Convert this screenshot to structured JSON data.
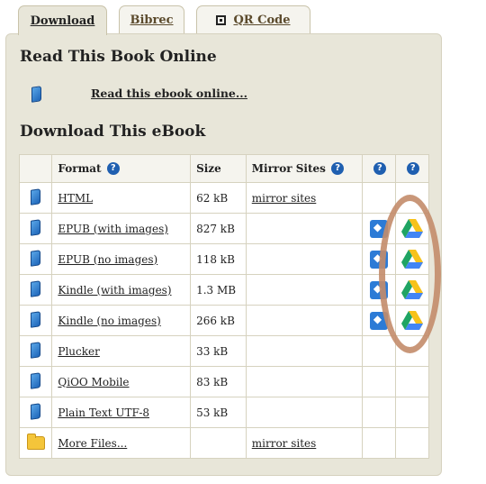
{
  "tabs": [
    {
      "label": "Download",
      "active": true
    },
    {
      "label": "Bibrec",
      "active": false
    },
    {
      "label": "QR Code",
      "active": false
    }
  ],
  "read_section": {
    "title": "Read This Book Online",
    "link": "Read this ebook online..."
  },
  "download_section": {
    "title": "Download This eBook",
    "columns": {
      "format": "Format",
      "size": "Size",
      "mirror": "Mirror Sites",
      "help": "?"
    },
    "rows": [
      {
        "format": "HTML",
        "size": "62 kB",
        "mirror": "mirror sites",
        "dropbox": false,
        "gdrive": false,
        "icon": "book-icon"
      },
      {
        "format": "EPUB (with images)",
        "size": "827 kB",
        "mirror": "",
        "dropbox": true,
        "gdrive": true,
        "icon": "book-icon"
      },
      {
        "format": "EPUB (no images)",
        "size": "118 kB",
        "mirror": "",
        "dropbox": true,
        "gdrive": true,
        "icon": "book-icon"
      },
      {
        "format": "Kindle (with images)",
        "size": "1.3 MB",
        "mirror": "",
        "dropbox": true,
        "gdrive": true,
        "icon": "book-icon"
      },
      {
        "format": "Kindle (no images)",
        "size": "266 kB",
        "mirror": "",
        "dropbox": true,
        "gdrive": true,
        "icon": "book-icon"
      },
      {
        "format": "Plucker",
        "size": "33 kB",
        "mirror": "",
        "dropbox": false,
        "gdrive": false,
        "icon": "book-icon"
      },
      {
        "format": "QiOO Mobile",
        "size": "83 kB",
        "mirror": "",
        "dropbox": false,
        "gdrive": false,
        "icon": "book-icon"
      },
      {
        "format": "Plain Text UTF-8",
        "size": "53 kB",
        "mirror": "",
        "dropbox": false,
        "gdrive": false,
        "icon": "book-icon"
      },
      {
        "format": "More Files...",
        "size": "",
        "mirror": "mirror sites",
        "dropbox": false,
        "gdrive": false,
        "icon": "folder-icon"
      }
    ]
  },
  "colors": {
    "panel_bg": "#e8e6d9",
    "highlight_oval": "#c38c6a",
    "help_blue": "#1f5fb0"
  }
}
